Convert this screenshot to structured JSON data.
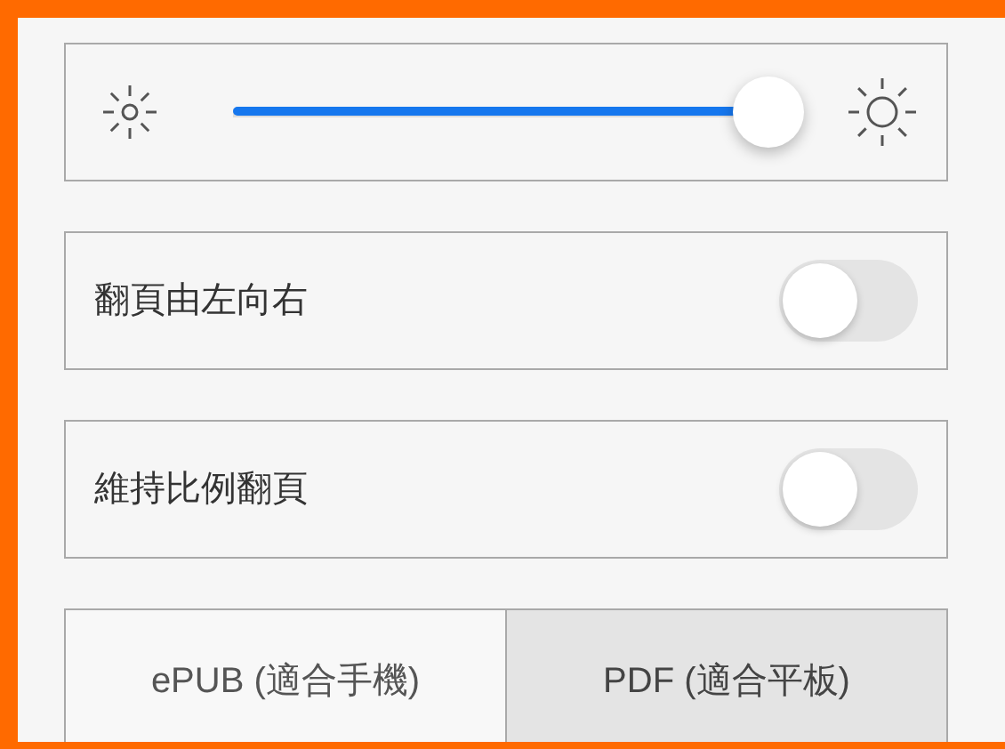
{
  "brightness": {
    "level": 0.95
  },
  "toggles": [
    {
      "label": "翻頁由左向右",
      "on": false
    },
    {
      "label": "維持比例翻頁",
      "on": false
    }
  ],
  "formats": [
    {
      "label": "ePUB (適合手機)",
      "selected": false
    },
    {
      "label": "PDF (適合平板)",
      "selected": true
    }
  ]
}
